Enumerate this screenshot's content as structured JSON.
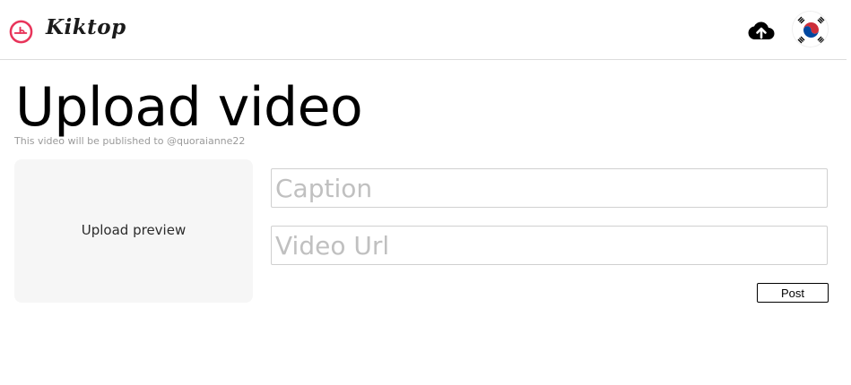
{
  "header": {
    "brand": "Kiktop",
    "upload_icon": "cloud-upload-icon",
    "avatar_icon": "korea-flag-avatar"
  },
  "main": {
    "title": "Upload video",
    "subtitle": "This video will be published to @quoraianne22",
    "preview_label": "Upload preview",
    "caption_placeholder": "Caption",
    "caption_value": "",
    "url_placeholder": "Video Url",
    "url_value": "",
    "post_label": "Post"
  },
  "colors": {
    "logo_accent": "#e8345a",
    "flag_red": "#cd2e3a",
    "flag_blue": "#0047a0"
  }
}
